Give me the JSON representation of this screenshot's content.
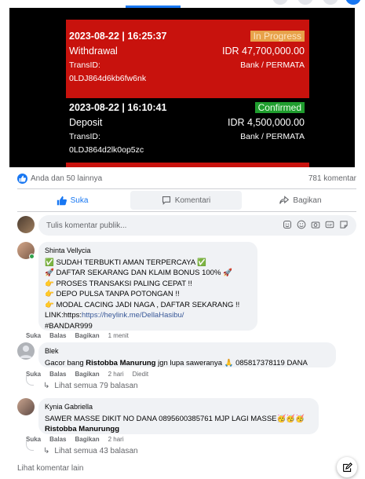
{
  "post_image": {
    "transactions": [
      {
        "date": "2023-08-22 | 16:25:37",
        "status": "In Progress",
        "type": "Withdrawal",
        "amount": "IDR 47,700,000.00",
        "transid_label": "TransID:",
        "bank": "Bank / PERMATA",
        "transid": "0LDJ864d6kb6fw6nk"
      },
      {
        "date": "2023-08-22 | 16:10:41",
        "status": "Confirmed",
        "type": "Deposit",
        "amount": "IDR 4,500,000.00",
        "transid_label": "TransID:",
        "bank": "Bank / PERMATA",
        "transid": "0LDJ864d2lk0op5zc"
      }
    ]
  },
  "stats": {
    "reactions_text": "Anda dan 50 lainnya",
    "comments_count": "781 komentar"
  },
  "actions": {
    "like": "Suka",
    "comment": "Komentari",
    "share": "Bagikan"
  },
  "compose": {
    "placeholder": "Tulis komentar publik..."
  },
  "comments": [
    {
      "author": "Shinta Vellycia",
      "lines": [
        "✅ SUDAH TERBUKTI AMAN TERPERCAYA ✅",
        "🚀 DAFTAR SEKARANG DAN KLAIM BONUS 100% 🚀",
        "👉 PROSES TRANSAKSI PALING CEPAT !!",
        "👉 DEPO PULSA TANPA POTONGAN !!",
        "👉 MODAL CACING JADI NAGA , DAFTAR SEKARANG !!"
      ],
      "link_prefix": "LINK:https:",
      "link": "https://heylink.me/DellaHasibu/",
      "hashtag": "#BANDAR999",
      "meta": {
        "like": "Suka",
        "reply": "Balas",
        "share": "Bagikan",
        "time": "1 menit"
      }
    },
    {
      "author": "Blek",
      "mention": "Ristobba Manurung",
      "text_before": "Gacor bang ",
      "text_after": " jgn lupa saweranya 🙏 085817378119 DANA",
      "meta": {
        "like": "Suka",
        "reply": "Balas",
        "share": "Bagikan",
        "time": "2 hari",
        "edited": "Diedit"
      },
      "replies": "Lihat semua 79 balasan"
    },
    {
      "author": "Kynia Gabriella",
      "text": "SAWER MASSE DIKIT NO DANA 0895600385761 MJP LAGI MASSE🥳🥳🥳",
      "mention": "Ristobba Manurungg",
      "meta": {
        "like": "Suka",
        "reply": "Balas",
        "share": "Bagikan",
        "time": "2 hari"
      },
      "replies": "Lihat semua 43 balasan"
    }
  ],
  "more_comments": "Lihat komentar lain",
  "colors": {
    "accent": "#1877f2",
    "receipt_red": "#c8120d",
    "in_progress": "#e8a24a",
    "confirmed": "#1f9d2e"
  }
}
